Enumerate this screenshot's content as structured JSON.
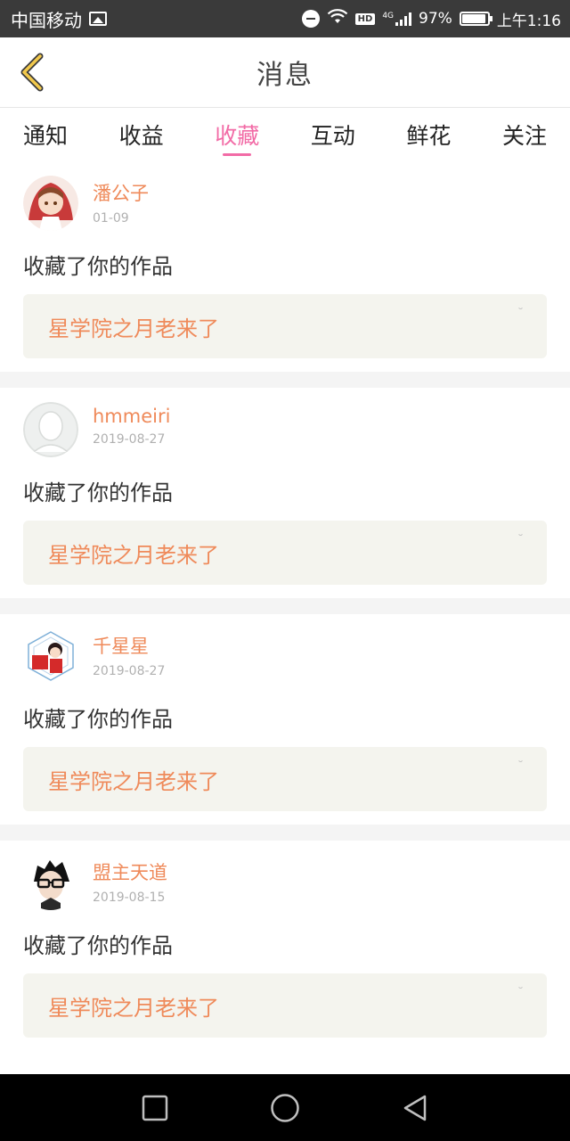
{
  "status_bar": {
    "carrier": "中国移动",
    "network": "4G",
    "hd_badge": "HD",
    "battery": "97%",
    "time": "上午1:16"
  },
  "header": {
    "title": "消息",
    "back_icon": "chevron-left-icon"
  },
  "tabs": [
    {
      "label": "通知",
      "active": false
    },
    {
      "label": "收益",
      "active": false
    },
    {
      "label": "收藏",
      "active": true
    },
    {
      "label": "互动",
      "active": false
    },
    {
      "label": "鲜花",
      "active": false
    },
    {
      "label": "关注",
      "active": false
    }
  ],
  "messages": [
    {
      "username": "潘公子",
      "date": "01-09",
      "action": "收藏了你的作品",
      "work": "星学院之月老来了"
    },
    {
      "username": "hmmeiri",
      "date": "2019-08-27",
      "action": "收藏了你的作品",
      "work": "星学院之月老来了"
    },
    {
      "username": "千星星",
      "date": "2019-08-27",
      "action": "收藏了你的作品",
      "work": "星学院之月老来了"
    },
    {
      "username": "盟主天道",
      "date": "2019-08-15",
      "action": "收藏了你的作品",
      "work": "星学院之月老来了"
    }
  ],
  "colors": {
    "accent_pink": "#f26ba6",
    "username_orange": "#ef8a5a",
    "status_bar_bg": "#3a3a3a",
    "work_box_bg": "#f4f4ee"
  }
}
